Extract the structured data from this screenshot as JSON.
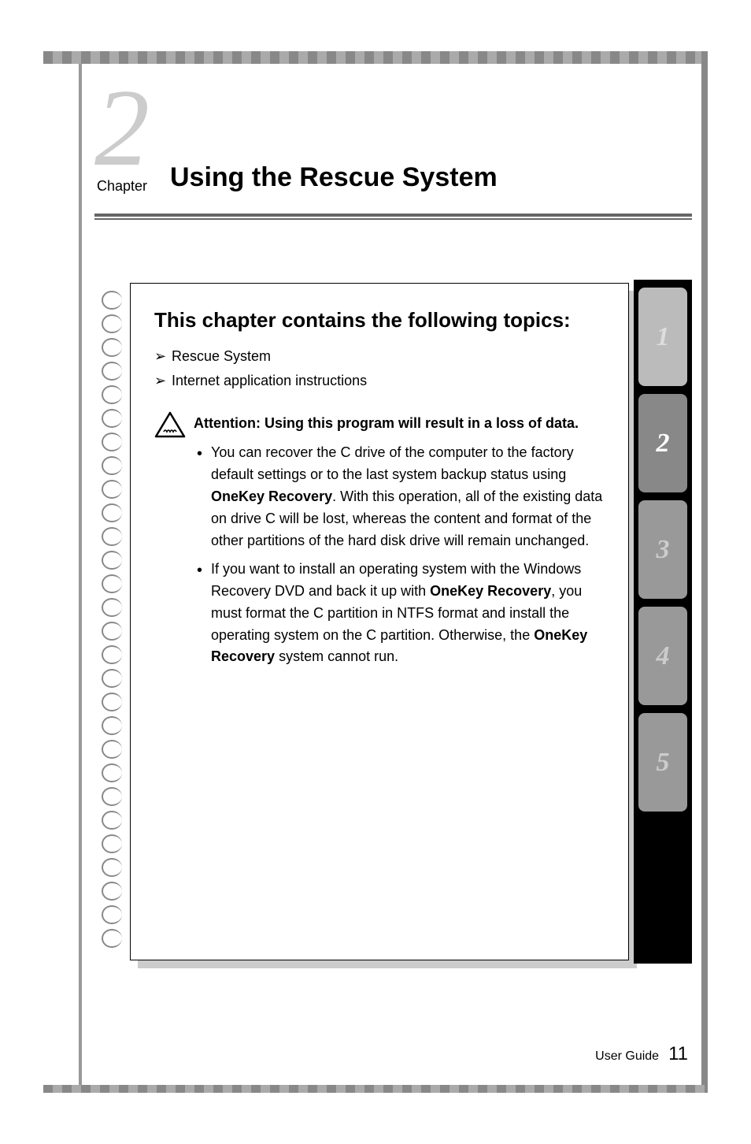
{
  "chapter": {
    "number": "2",
    "label": "Chapter",
    "title": "Using the Rescue System"
  },
  "topics": {
    "heading": "This chapter contains the following topics:",
    "items": [
      "Rescue System",
      "Internet application instructions"
    ]
  },
  "attention": {
    "title": "Attention: Using this program will result in a loss of data.",
    "bullets": [
      {
        "pre": "You can recover the C drive of the computer to the factory default settings or to the last system backup status using ",
        "bold1": "OneKey Recovery",
        "mid": ". With this operation, all of the existing data on drive C will be lost, whereas the content and format of the other partitions of the hard disk drive will remain unchanged.",
        "bold2": "",
        "post": ""
      },
      {
        "pre": "If you want to install an operating system with the Windows Recovery DVD and back it up with ",
        "bold1": "OneKey Recovery",
        "mid": ", you must format the C partition in NTFS format and install the operating system on the C partition. Otherwise, the ",
        "bold2": "OneKey Recovery",
        "post": " system cannot run."
      }
    ]
  },
  "tabs": [
    "1",
    "2",
    "3",
    "4",
    "5"
  ],
  "footer": {
    "label": "User Guide",
    "page": "11"
  }
}
